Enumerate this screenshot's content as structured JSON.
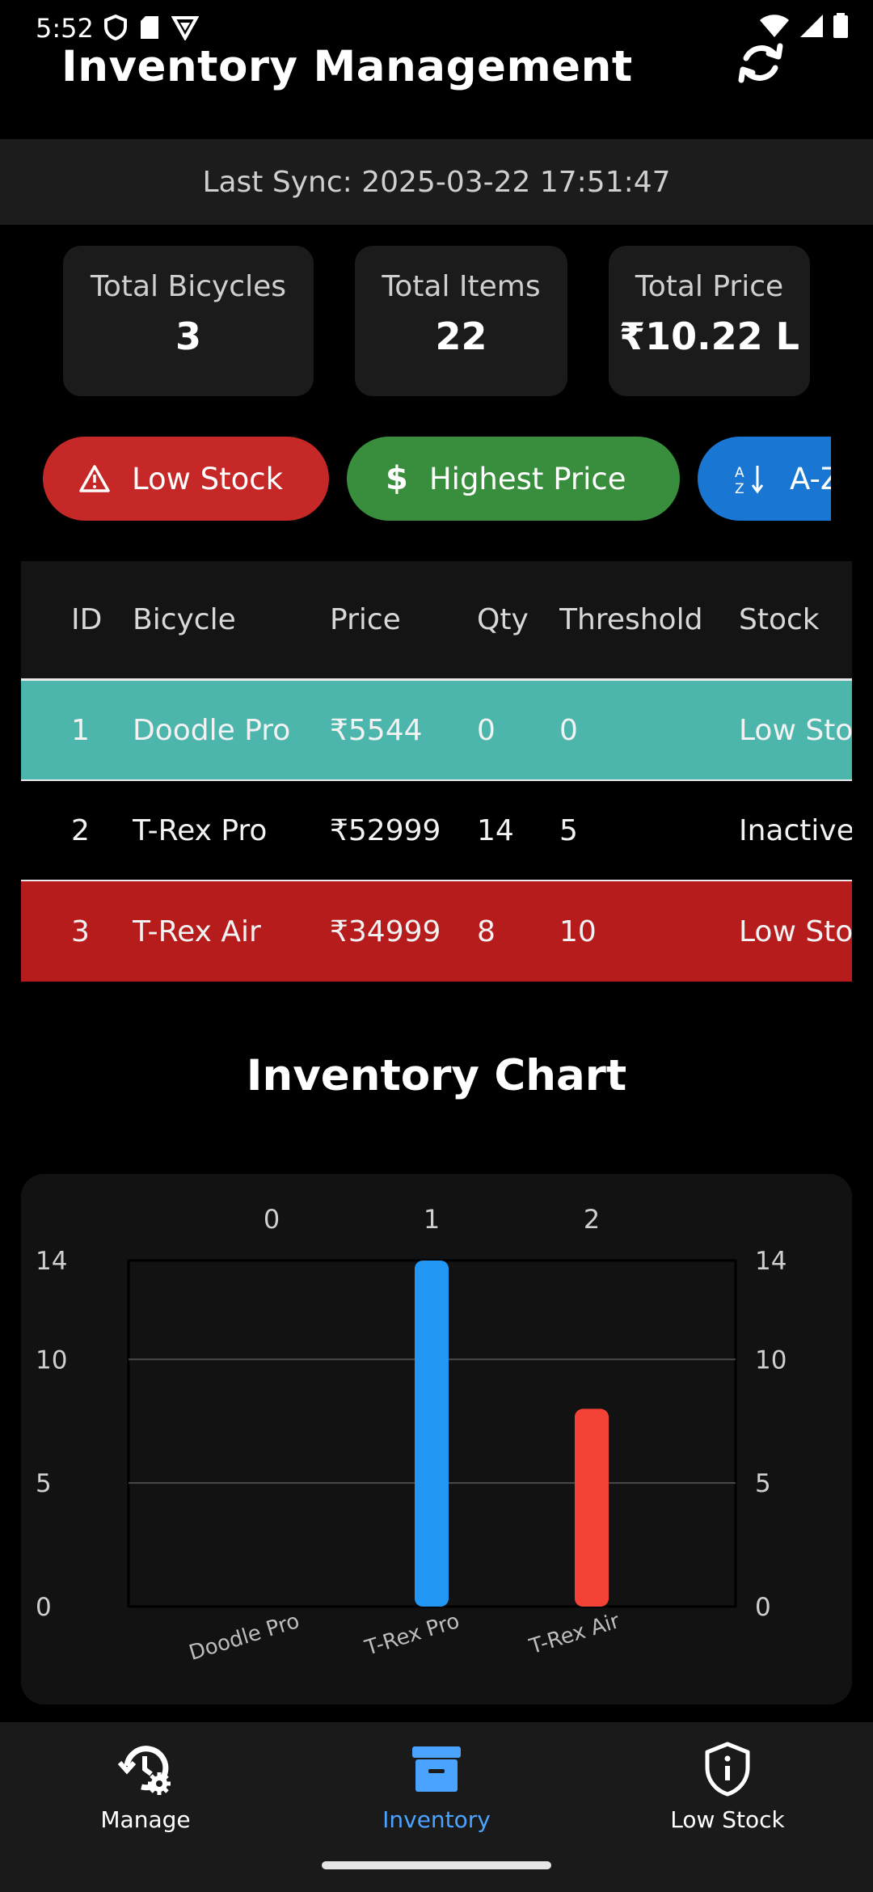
{
  "status_bar": {
    "time": "5:52"
  },
  "header": {
    "title": "Inventory Management"
  },
  "sync": {
    "text": "Last Sync: 2025-03-22 17:51:47"
  },
  "stats": [
    {
      "label": "Total Bicycles",
      "value": "3"
    },
    {
      "label": "Total Items",
      "value": "22"
    },
    {
      "label": "Total Price",
      "value": "₹10.22 L"
    }
  ],
  "filters": {
    "low_stock": "Low Stock",
    "highest_price": "Highest Price",
    "az": "A-Z"
  },
  "colors": {
    "low_stock_btn": "#c62828",
    "highest_price_btn": "#388e3c",
    "az_btn": "#1976d2",
    "row_teal": "#4db6ac",
    "row_red": "#b71c1c",
    "bar_blue": "#2196f3",
    "bar_red": "#f44336",
    "nav_active": "#4aa3ff"
  },
  "table": {
    "headers": [
      "ID",
      "Bicycle",
      "Price",
      "Qty",
      "Threshold",
      "Stock"
    ],
    "rows": [
      [
        "1",
        "Doodle Pro",
        "₹5544",
        "0",
        "0",
        "Low Sto"
      ],
      [
        "2",
        "T-Rex Pro",
        "₹52999",
        "14",
        "5",
        "Inactive"
      ],
      [
        "3",
        "T-Rex Air",
        "₹34999",
        "8",
        "10",
        "Low Sto"
      ]
    ]
  },
  "chart": {
    "title": "Inventory Chart"
  },
  "chart_data": {
    "type": "bar",
    "categories": [
      "Doodle Pro",
      "T-Rex Pro",
      "T-Rex Air"
    ],
    "top_labels": [
      "0",
      "1",
      "2"
    ],
    "values": [
      0,
      14,
      8
    ],
    "bar_colors": [
      "#2196f3",
      "#2196f3",
      "#f44336"
    ],
    "ylim": [
      0,
      14
    ],
    "yticks": [
      0,
      5,
      10,
      14
    ],
    "grid": true
  },
  "nav": {
    "manage": "Manage",
    "inventory": "Inventory",
    "low_stock": "Low Stock"
  }
}
